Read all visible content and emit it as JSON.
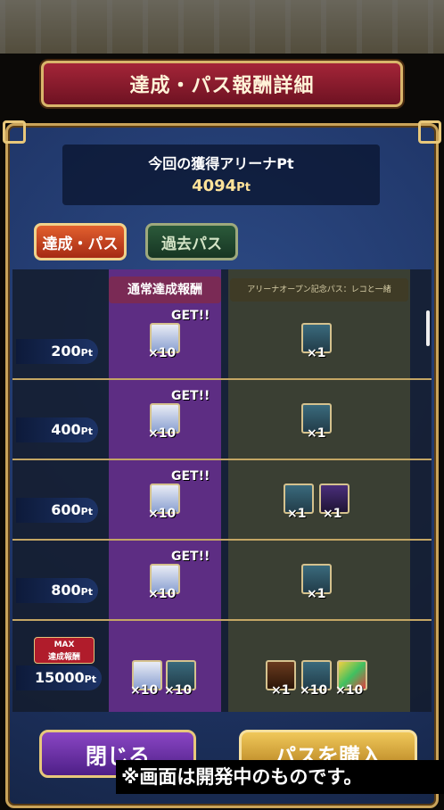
{
  "title": "達成・パス報酬詳細",
  "points": {
    "label": "今回の獲得アリーナPt",
    "value": "4094",
    "unit": "Pt"
  },
  "tabs": [
    {
      "label": "達成・パス",
      "active": true
    },
    {
      "label": "過去パス",
      "active": false
    }
  ],
  "columns": {
    "normal": "通常達成報酬",
    "pass": "アリーナオープン記念パス：レコと一緒"
  },
  "get_label": "GET!!",
  "rows": [
    {
      "pt": "200",
      "unit": "Pt",
      "normal": [
        {
          "icon": "ticket-icon",
          "qty": "×10"
        }
      ],
      "pass": [
        {
          "icon": "scroll-icon",
          "qty": "×1"
        }
      ]
    },
    {
      "pt": "400",
      "unit": "Pt",
      "normal": [
        {
          "icon": "ticket-icon",
          "qty": "×10"
        }
      ],
      "pass": [
        {
          "icon": "scroll-icon",
          "qty": "×1"
        }
      ]
    },
    {
      "pt": "600",
      "unit": "Pt",
      "normal": [
        {
          "icon": "ticket-icon",
          "qty": "×10"
        }
      ],
      "pass": [
        {
          "icon": "scroll-icon",
          "qty": "×1"
        },
        {
          "icon": "crystal-icon",
          "qty": "×1"
        }
      ]
    },
    {
      "pt": "800",
      "unit": "Pt",
      "normal": [
        {
          "icon": "ticket-icon",
          "qty": "×10"
        }
      ],
      "pass": [
        {
          "icon": "scroll-icon",
          "qty": "×1"
        }
      ]
    }
  ],
  "max_row": {
    "badge_top": "MAX",
    "badge_bottom": "達成報酬",
    "pt": "15000",
    "unit": "Pt",
    "normal": [
      {
        "icon": "ticket-icon",
        "qty": "×10"
      },
      {
        "icon": "scroll-icon",
        "qty": "×10"
      }
    ],
    "pass": [
      {
        "icon": "chest-icon",
        "qty": "×1"
      },
      {
        "icon": "scroll-icon",
        "qty": "×10"
      },
      {
        "icon": "gem-icon",
        "qty": "×10"
      }
    ]
  },
  "buttons": {
    "close": "閉じる",
    "buy": "パスを購入"
  },
  "note": "※画面は開発中のものです。"
}
